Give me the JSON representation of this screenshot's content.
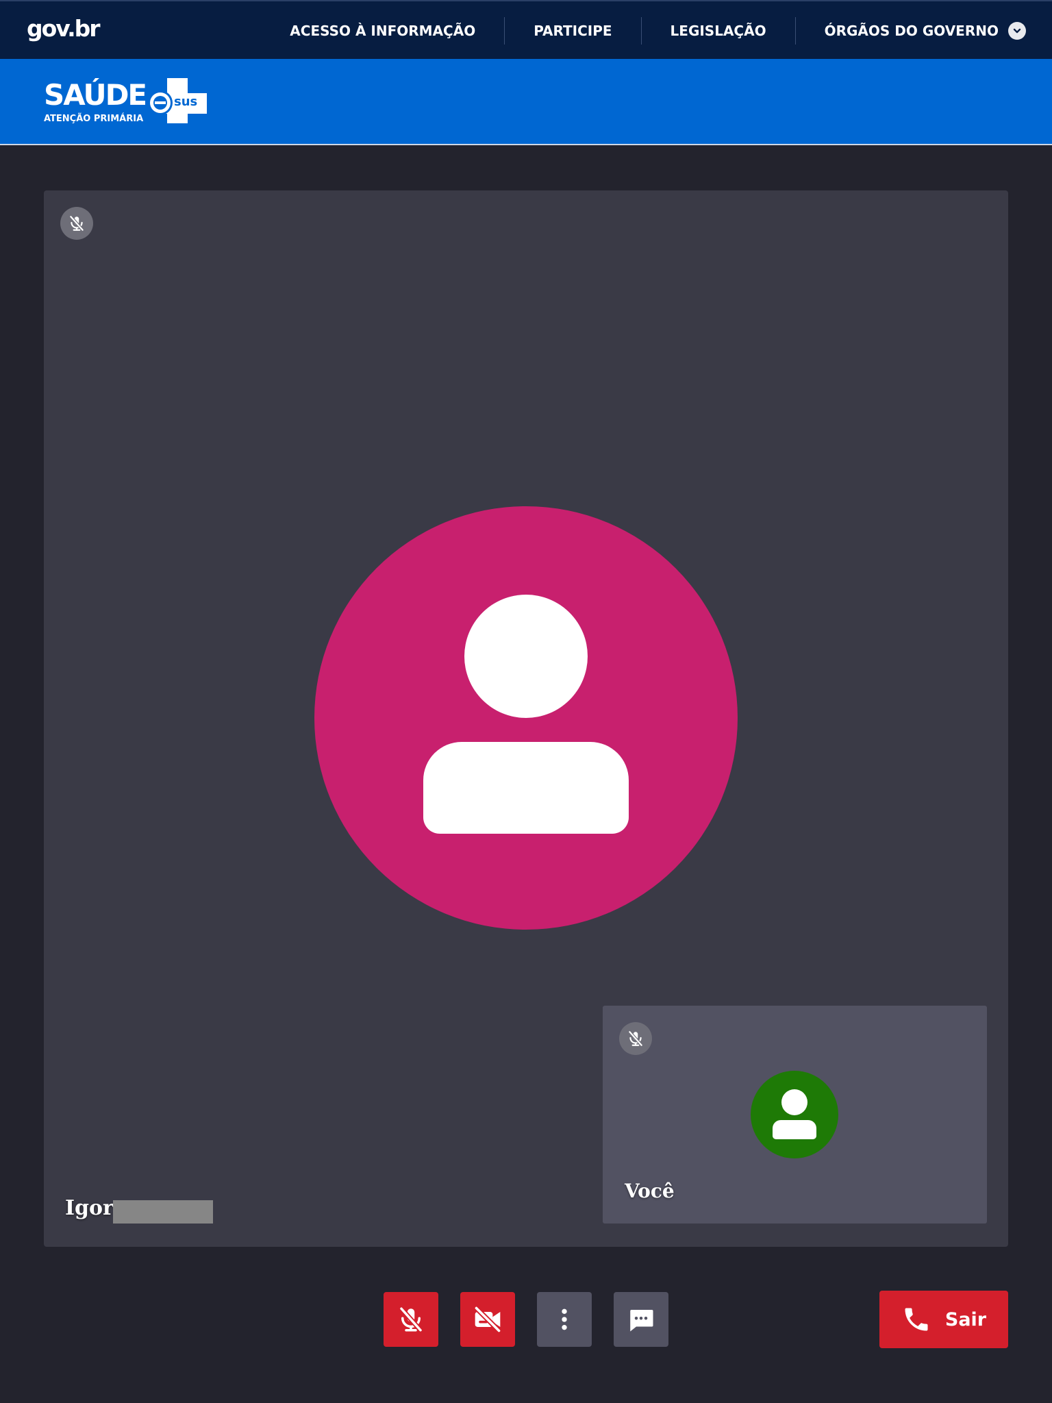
{
  "govbar": {
    "logo": "gov.br",
    "nav": [
      {
        "label": "ACESSO À INFORMAÇÃO"
      },
      {
        "label": "PARTICIPE"
      },
      {
        "label": "LEGISLAÇÃO"
      },
      {
        "label": "ÓRGÃOS DO GOVERNO"
      }
    ]
  },
  "brand": {
    "title": "SAÚDE",
    "badge": "sus",
    "subtitle": "ATENÇÃO PRIMÁRIA"
  },
  "remote_participant": {
    "name": "Igor",
    "avatar_color": "#c8206e",
    "muted": true
  },
  "self_participant": {
    "name": "Você",
    "avatar_color": "#1e7a06",
    "muted": true
  },
  "controls": {
    "mic": {
      "icon": "mic-off-icon",
      "state": "off"
    },
    "camera": {
      "icon": "camera-off-icon",
      "state": "off"
    },
    "more": {
      "icon": "more-vertical-icon"
    },
    "chat": {
      "icon": "chat-icon"
    },
    "leave_label": "Sair"
  },
  "colors": {
    "govbar": "#071d41",
    "appbar": "#0067d2",
    "danger": "#d41f2c"
  }
}
